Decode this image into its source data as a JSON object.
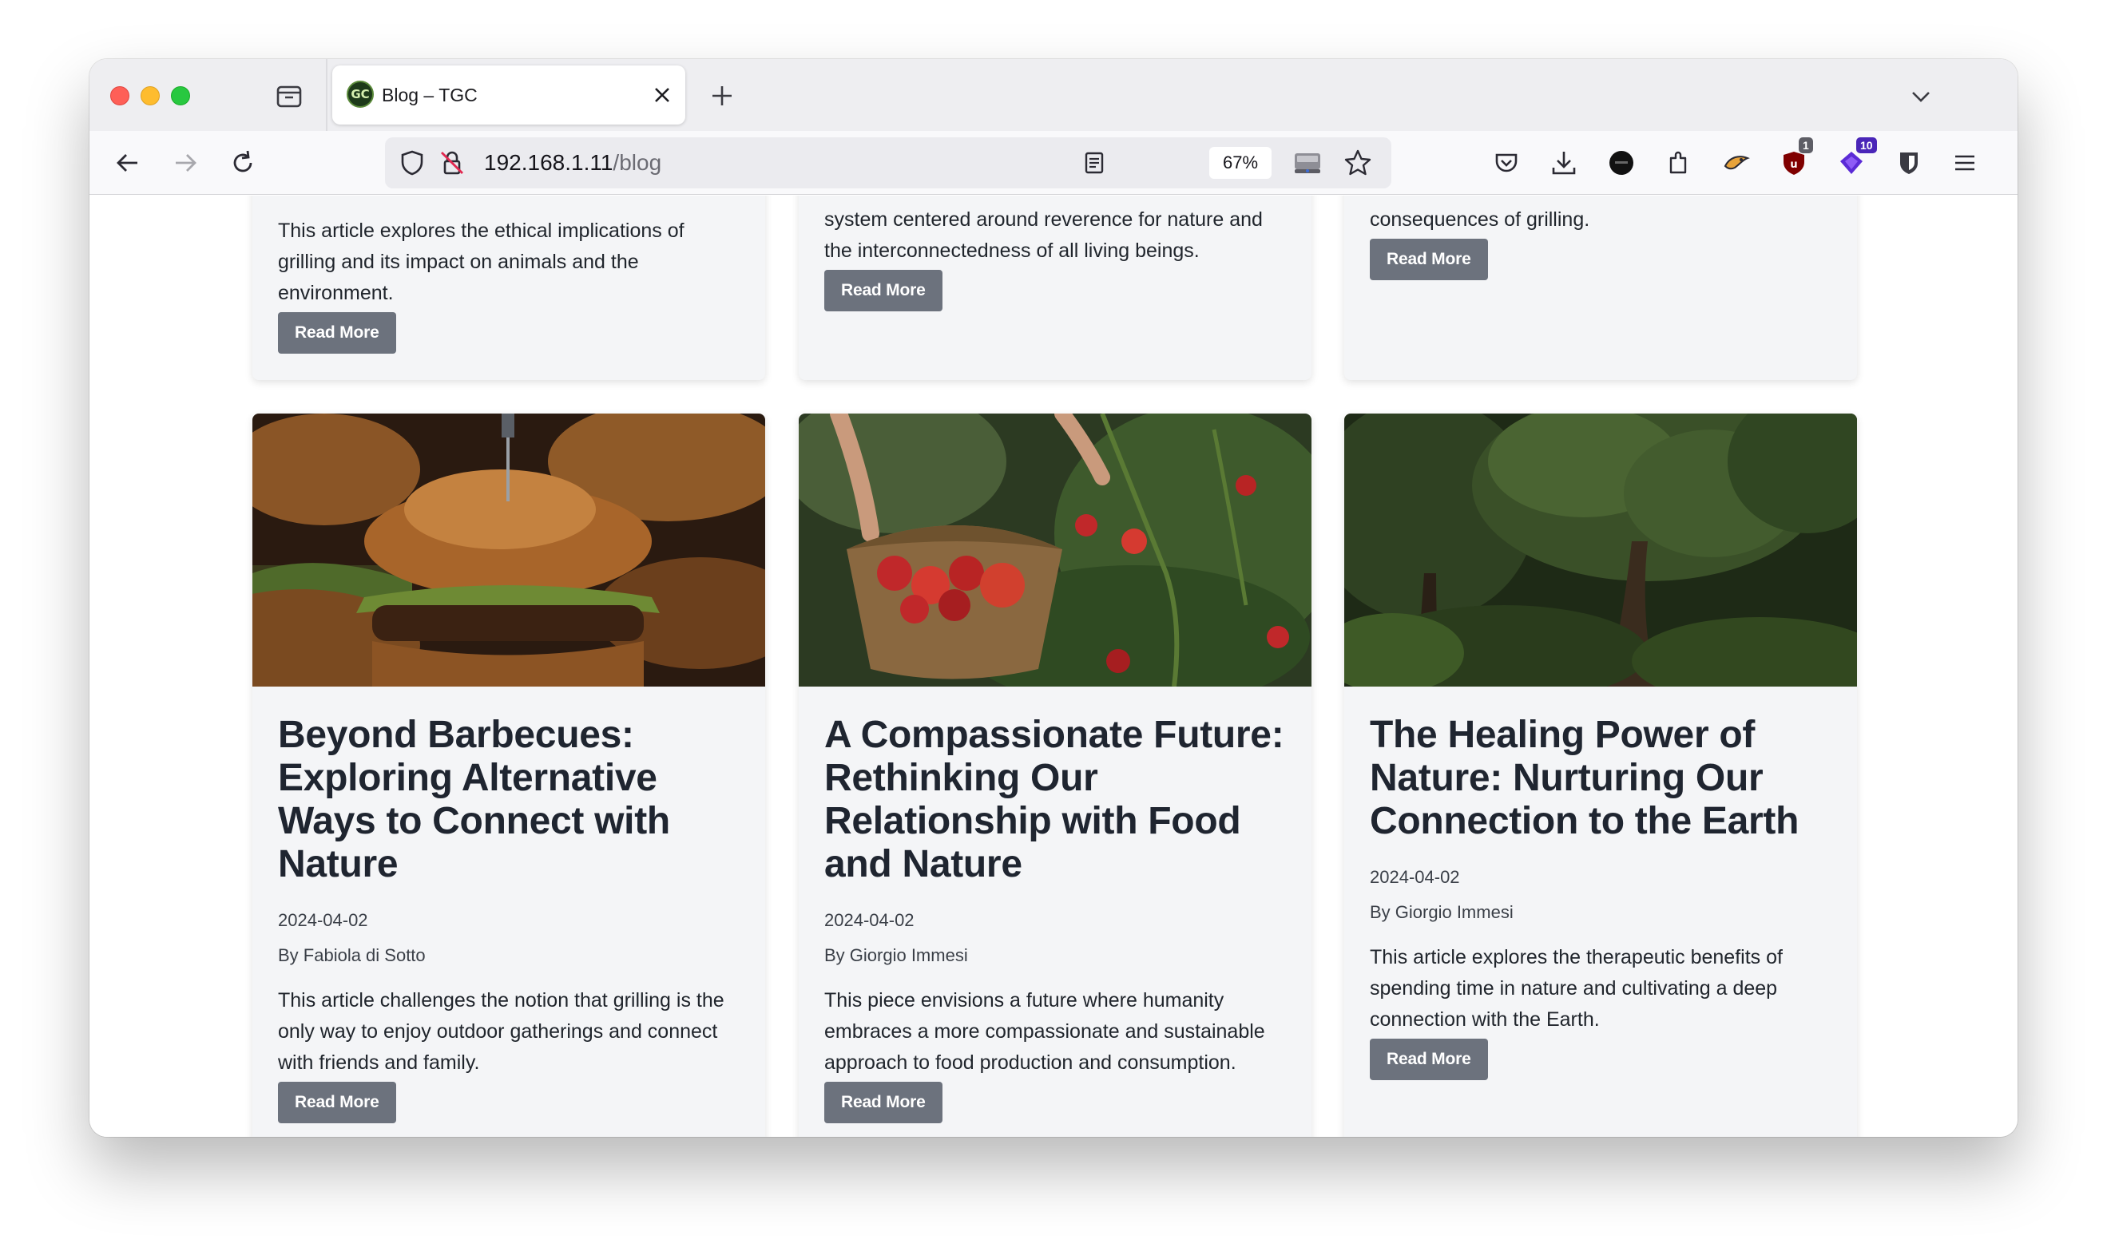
{
  "browser": {
    "tab": {
      "title": "Blog – TGC",
      "favicon_text": "GC"
    },
    "url": {
      "host": "192.168.1.11",
      "path": "/blog"
    },
    "zoom": "67%",
    "extension_badges": {
      "ublock": "1",
      "proton": "10"
    }
  },
  "top_row_cards": [
    {
      "excerpt_tail": "This article explores the ethical implications of grilling and its impact on animals and the environment.",
      "read_more": "Read More"
    },
    {
      "excerpt_tail": "system centered around reverence for nature and the interconnectedness of all living beings.",
      "read_more": "Read More"
    },
    {
      "excerpt_tail": "consequences of grilling.",
      "read_more": "Read More"
    }
  ],
  "cards": [
    {
      "title": "Beyond Barbecues: Exploring Alternative Ways to Connect with Nature",
      "date": "2024-04-02",
      "author": "By Fabiola di Sotto",
      "excerpt": "This article challenges the notion that grilling is the only way to enjoy outdoor gatherings and connect with friends and family.",
      "read_more": "Read More"
    },
    {
      "title": "A Compassionate Future: Rethinking Our Relationship with Food and Nature",
      "date": "2024-04-02",
      "author": "By Giorgio Immesi",
      "excerpt": "This piece envisions a future where humanity embraces a more compassionate and sustainable approach to food production and consumption.",
      "read_more": "Read More"
    },
    {
      "title": "The Healing Power of Nature: Nurturing Our Connection to the Earth",
      "date": "2024-04-02",
      "author": "By Giorgio Immesi",
      "excerpt": "This article explores the therapeutic benefits of spending time in nature and cultivating a deep connection with the Earth.",
      "read_more": "Read More"
    }
  ]
}
